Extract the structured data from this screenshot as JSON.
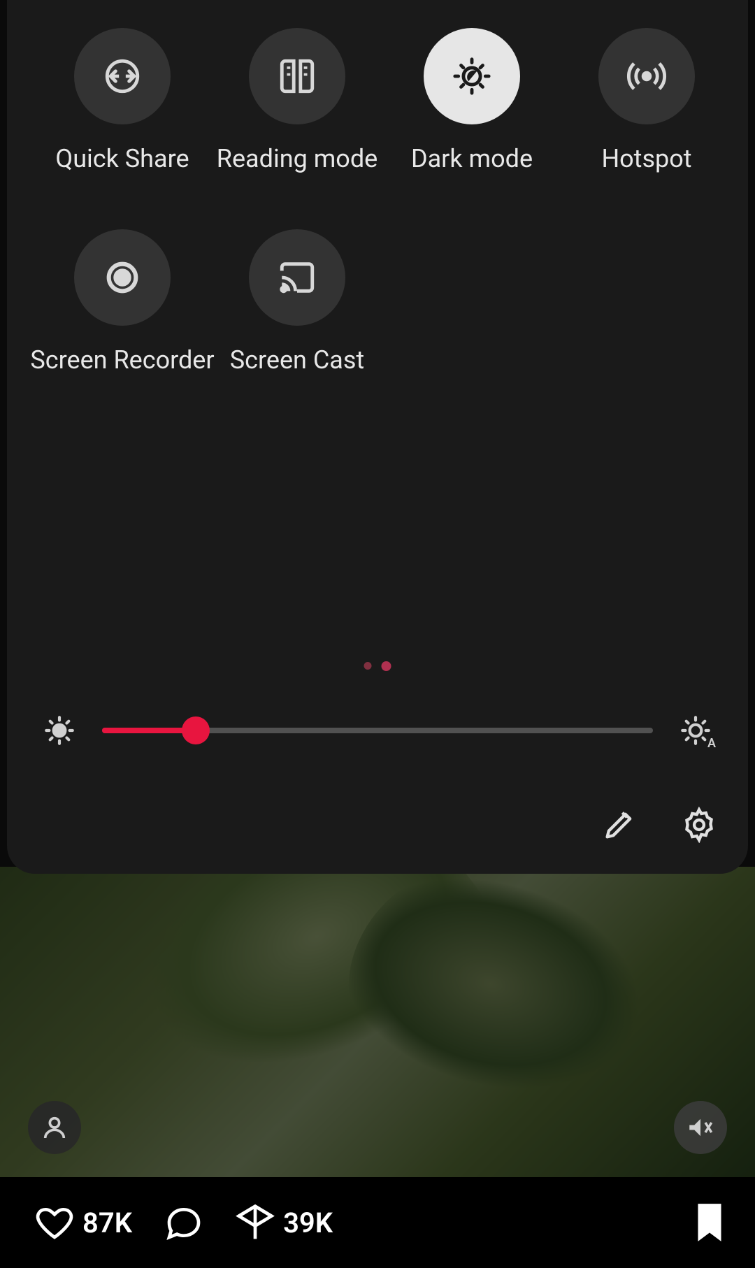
{
  "quick_settings": {
    "tiles": [
      {
        "id": "quick-share",
        "label": "Quick Share",
        "icon": "share-sync-icon",
        "active": false
      },
      {
        "id": "reading-mode",
        "label": "Reading mode",
        "icon": "book-icon",
        "active": false
      },
      {
        "id": "dark-mode",
        "label": "Dark mode",
        "icon": "moon-sun-icon",
        "active": true
      },
      {
        "id": "hotspot",
        "label": "Hotspot",
        "icon": "hotspot-icon",
        "active": false
      },
      {
        "id": "screen-recorder",
        "label": "Screen Recorder",
        "icon": "record-icon",
        "active": false
      },
      {
        "id": "screen-cast",
        "label": "Screen Cast",
        "icon": "cast-icon",
        "active": false
      }
    ],
    "page_indicator": {
      "count": 2,
      "current": 2
    },
    "brightness": {
      "percent": 17
    },
    "actions": {
      "edit": "edit-icon",
      "settings": "gear-icon"
    }
  },
  "background_app": {
    "profile_icon": "person-icon",
    "mute_icon": "volume-off-icon",
    "bottom_bar": {
      "likes": "87K",
      "shares": "39K",
      "comment_icon": "comment-icon",
      "heart_icon": "heart-icon",
      "send_icon": "send-icon",
      "bookmark_icon": "bookmark-icon"
    }
  },
  "colors": {
    "panel_bg": "#1a1a1a",
    "tile_bg": "#333333",
    "tile_active_bg": "#e6e6e6",
    "accent": "#e8153f"
  }
}
